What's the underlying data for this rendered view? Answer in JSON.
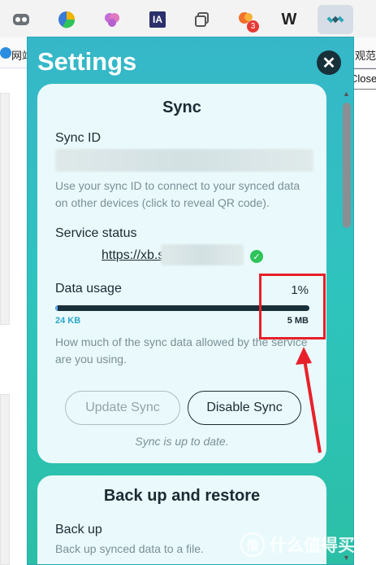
{
  "browser": {
    "extensions": [
      {
        "name": "toggle-icon"
      },
      {
        "name": "chart-pie-icon"
      },
      {
        "name": "brain-icon"
      },
      {
        "name": "internet-archive-icon",
        "text": "IA"
      },
      {
        "name": "copy-tabs-icon"
      },
      {
        "name": "notification-extension-icon",
        "badge": "3"
      },
      {
        "name": "w-extension-icon",
        "text": "W"
      },
      {
        "name": "satellite-icon",
        "active": true
      }
    ],
    "bookmarks": {
      "left": "网站",
      "right": "观范"
    },
    "tooltip": "Close"
  },
  "popup": {
    "title": "Settings",
    "close_icon": "close-icon",
    "sync": {
      "title": "Sync",
      "sync_id_label": "Sync ID",
      "sync_id_help": "Use your sync ID to connect to your synced data on other devices (click to reveal QR code).",
      "service_status_label": "Service status",
      "service_url": "https://xb.s",
      "status_icon": "check-icon",
      "data_usage_label": "Data usage",
      "data_usage_percent_text": "1%",
      "data_usage_fraction": 0.01,
      "usage_min": "24 KB",
      "usage_max": "5 MB",
      "usage_help": "How much of the sync data allowed by the service are you using.",
      "update_button": "Update Sync",
      "disable_button": "Disable Sync",
      "status_text": "Sync is up to date."
    },
    "backup": {
      "title": "Back up and restore",
      "back_up_label": "Back up",
      "back_up_help": "Back up synced data to a file."
    }
  },
  "watermark": {
    "text": "什么值得买",
    "badge": "值"
  },
  "colors": {
    "popup_gradient_top": "#36b7c9",
    "popup_gradient_bottom": "#2bbfa6",
    "card_bg": "#eafafc",
    "accent_dark": "#17303a",
    "annotation_red": "#e8202a"
  }
}
